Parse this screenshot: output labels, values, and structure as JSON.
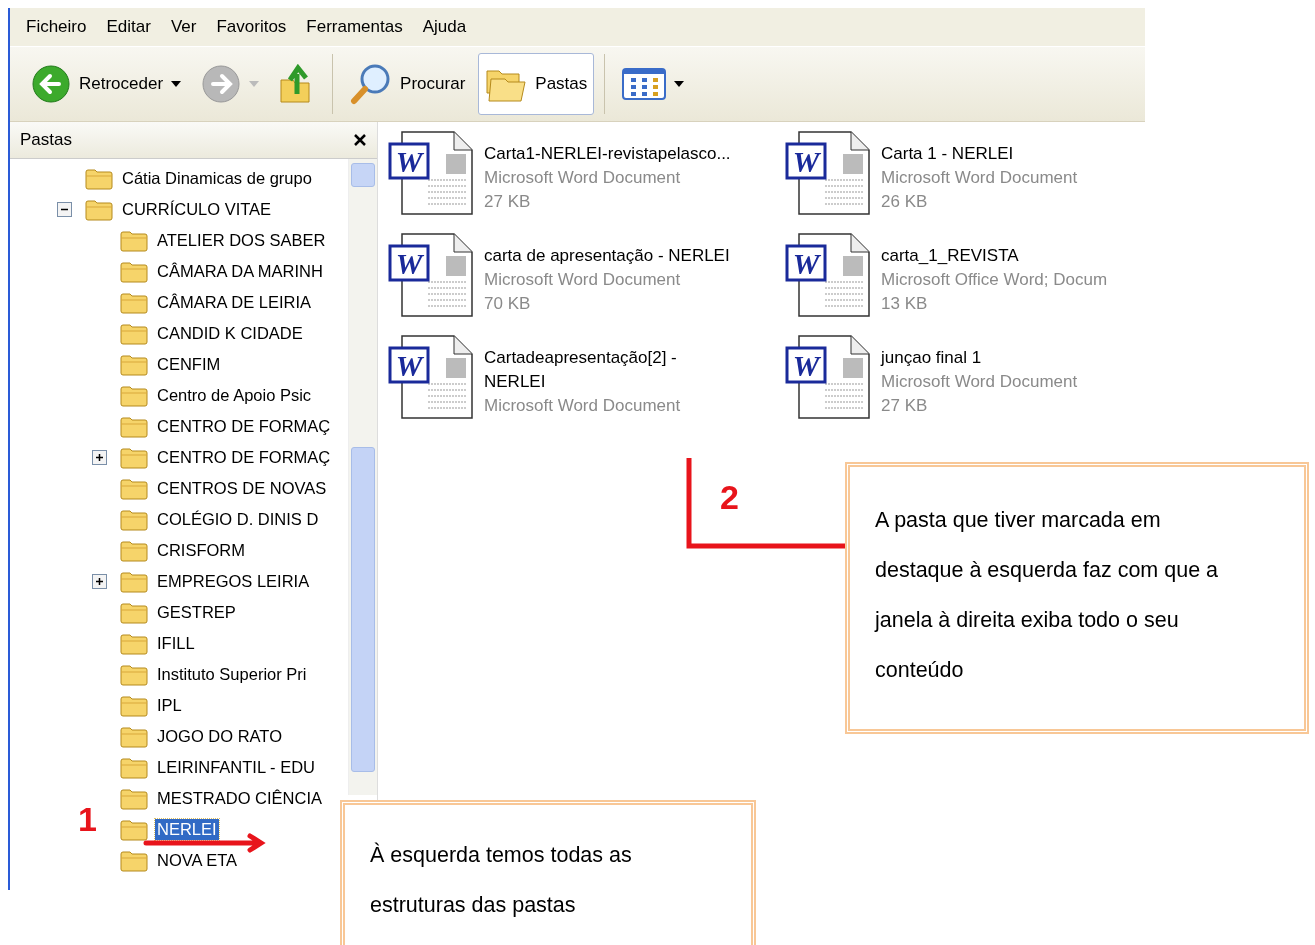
{
  "menu": [
    "Ficheiro",
    "Editar",
    "Ver",
    "Favoritos",
    "Ferramentas",
    "Ajuda"
  ],
  "toolbar": [
    {
      "kind": "back",
      "label": "Retroceder",
      "disabled": false,
      "dropdown": true
    },
    {
      "kind": "forward",
      "disabled": true,
      "dropdown": true
    },
    {
      "kind": "up",
      "disabled": false
    },
    {
      "kind": "separator"
    },
    {
      "kind": "search",
      "label": "Procurar",
      "selected": false
    },
    {
      "kind": "folders",
      "label": "Pastas",
      "selected": true
    },
    {
      "kind": "separator"
    },
    {
      "kind": "views",
      "dropdown": true
    }
  ],
  "folders_pane": {
    "title": "Pastas",
    "tree": [
      {
        "label": "Cátia Dinamicas de grupo",
        "selected": false
      },
      {
        "label": "CURRÍCULO VITAE",
        "selected": false,
        "expanded": true,
        "children": [
          {
            "label": "ATELIER DOS SABER",
            "selected": false
          },
          {
            "label": "CÂMARA DA MARINH",
            "selected": false
          },
          {
            "label": "CÂMARA DE LEIRIA",
            "selected": false
          },
          {
            "label": "CANDID K CIDADE",
            "selected": false
          },
          {
            "label": "CENFIM",
            "selected": false
          },
          {
            "label": "Centro de Apoio Psic",
            "selected": false
          },
          {
            "label": "CENTRO DE FORMAÇ",
            "selected": false
          },
          {
            "label": "CENTRO DE FORMAÇ",
            "selected": false,
            "expanded": false
          },
          {
            "label": "CENTROS DE NOVAS",
            "selected": false
          },
          {
            "label": "COLÉGIO D. DINIS D",
            "selected": false
          },
          {
            "label": "CRISFORM",
            "selected": false
          },
          {
            "label": "EMPREGOS LEIRIA",
            "selected": false,
            "expanded": false
          },
          {
            "label": "GESTREP",
            "selected": false
          },
          {
            "label": "IFILL",
            "selected": false
          },
          {
            "label": "Instituto Superior Pri",
            "selected": false
          },
          {
            "label": "IPL",
            "selected": false
          },
          {
            "label": "JOGO DO RATO",
            "selected": false
          },
          {
            "label": "LEIRINFANTIL - EDU",
            "selected": false
          },
          {
            "label": "MESTRADO CIÊNCIA",
            "selected": false
          },
          {
            "label": "NERLEI",
            "selected": true
          },
          {
            "label": "NOVA ETA",
            "selected": false
          }
        ]
      }
    ]
  },
  "files": [
    {
      "icon_letter": "W",
      "name_lines": [
        "Carta1-NERLEI-revistapelasco..."
      ],
      "type": "Microsoft Word Document",
      "size": "27 KB"
    },
    {
      "icon_letter": "W",
      "name_lines": [
        "Carta 1 - NERLEI"
      ],
      "type": "Microsoft Word Document",
      "size": "26 KB"
    },
    {
      "icon_letter": "W",
      "name_lines": [
        "carta de apresentação - NERLEI"
      ],
      "type": "Microsoft Word Document",
      "size": "70 KB"
    },
    {
      "icon_letter": "W",
      "name_lines": [
        "carta_1_REVISTA"
      ],
      "type": "Microsoft Office Word; Docum",
      "size": "13 KB"
    },
    {
      "icon_letter": "W",
      "name_lines": [
        "Cartadeapresentação[2] -",
        "NERLEI"
      ],
      "type": "Microsoft Word Document"
    },
    {
      "icon_letter": "W",
      "name_lines": [
        "junçao final 1"
      ],
      "type": "Microsoft Word Document",
      "size": "27 KB"
    }
  ],
  "annotations": [
    {
      "number": "1",
      "text": "À esquerda temos todas as estruturas das pastas"
    },
    {
      "number": "2",
      "text": "A pasta que tiver marcada em destaque à esquerda faz com que a janela à direita exiba todo o seu conteúdo"
    }
  ]
}
